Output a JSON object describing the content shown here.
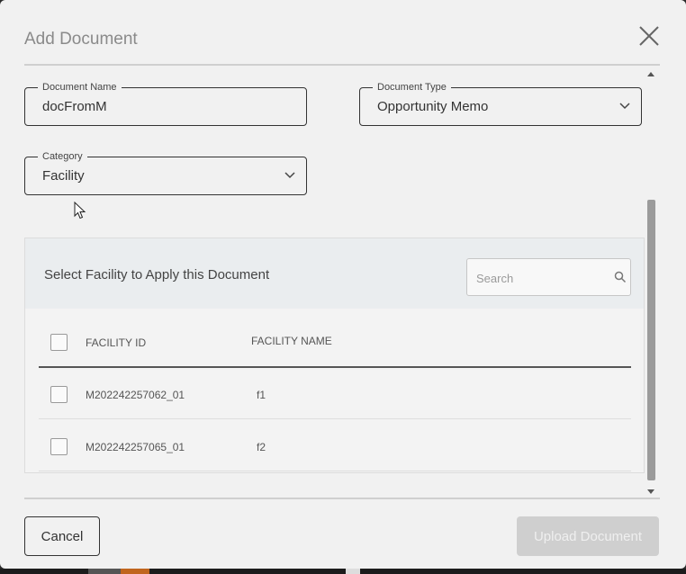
{
  "dialog": {
    "title": "Add Document"
  },
  "form": {
    "document_name": {
      "label": "Document Name",
      "value": "docFromM"
    },
    "document_type": {
      "label": "Document Type",
      "value": "Opportunity Memo"
    },
    "category": {
      "label": "Category",
      "value": "Facility"
    }
  },
  "facility_panel": {
    "title": "Select Facility to Apply this Document",
    "search_placeholder": "Search",
    "columns": [
      "FACILITY ID",
      "FACILITY NAME"
    ],
    "rows": [
      {
        "facility_id": "M202242257062_01",
        "facility_name": "f1"
      },
      {
        "facility_id": "M202242257065_01",
        "facility_name": "f2"
      }
    ]
  },
  "footer": {
    "cancel_label": "Cancel",
    "upload_label": "Upload Document"
  },
  "icons": {
    "close": "close-icon",
    "chevron": "chevron-down-icon",
    "search": "search-icon"
  }
}
